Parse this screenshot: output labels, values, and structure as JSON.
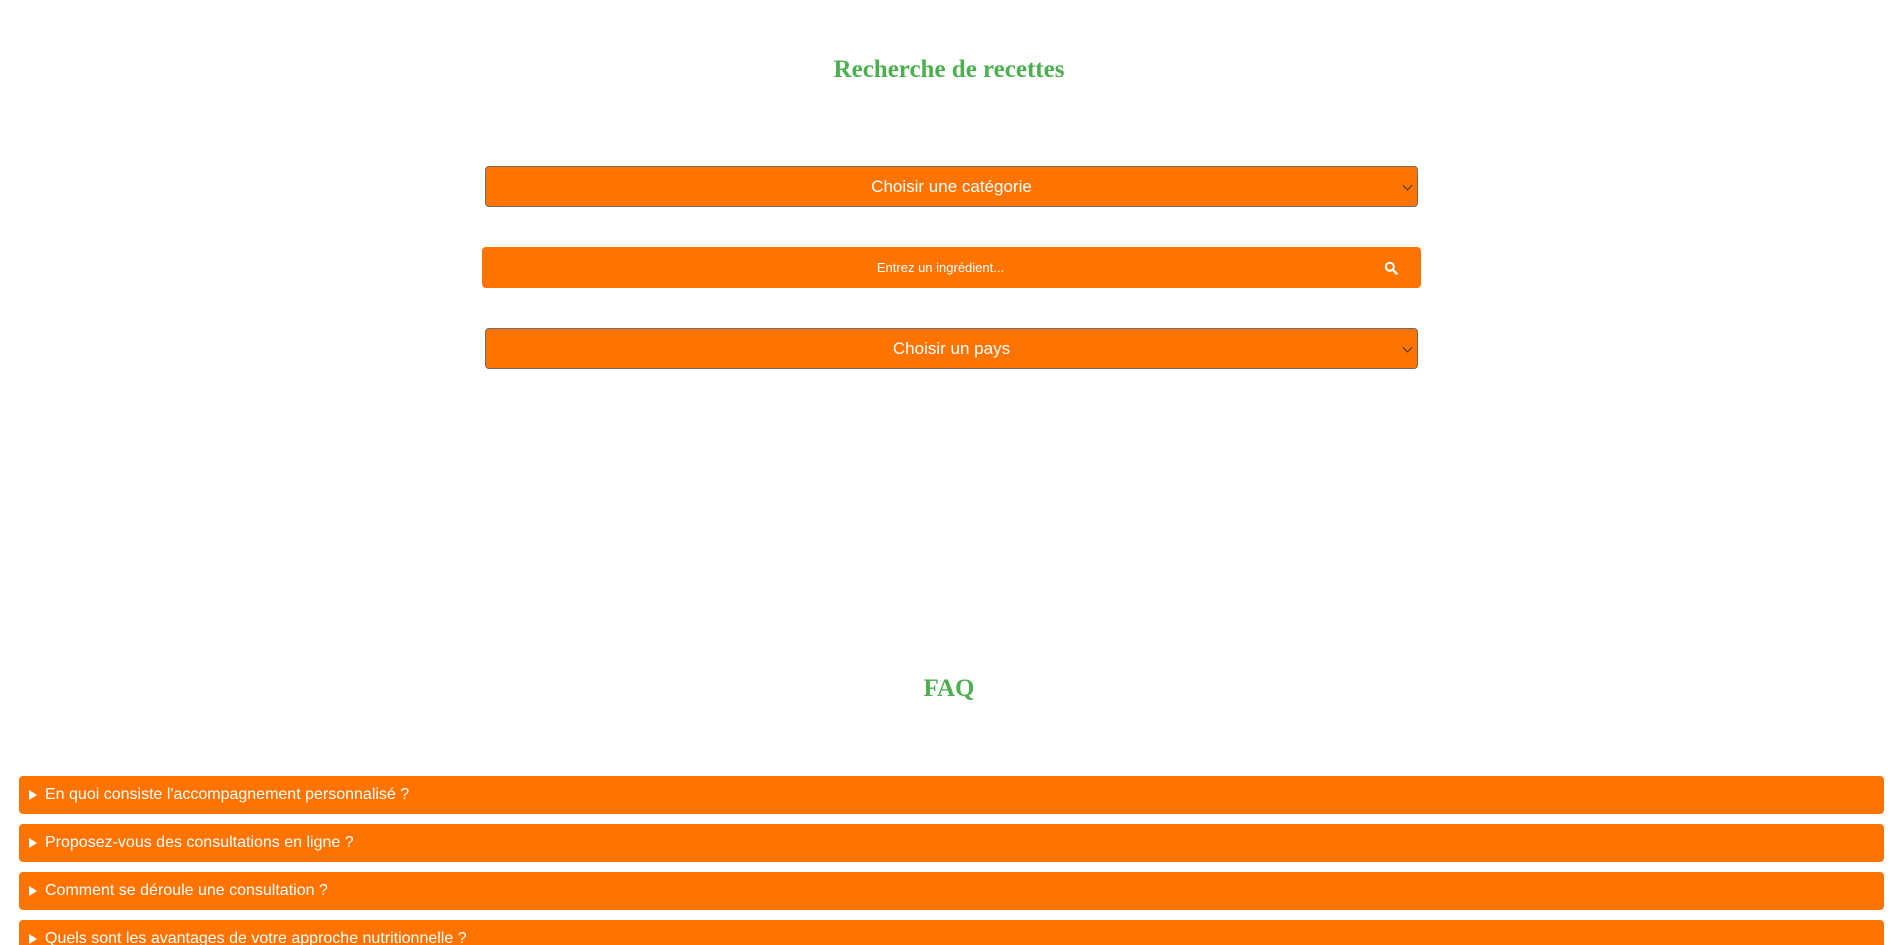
{
  "search_section": {
    "title": "Recherche de recettes",
    "category_select": {
      "selected": "Choisir une catégorie",
      "icon": "chevron-down-icon"
    },
    "ingredient_search": {
      "placeholder": "Entrez un ingrédient...",
      "icon": "search-icon"
    },
    "country_select": {
      "selected": "Choisir un pays",
      "icon": "chevron-down-icon"
    }
  },
  "faq_section": {
    "title": "FAQ",
    "items": [
      {
        "question": "En quoi consiste l'accompagnement personnalisé ?"
      },
      {
        "question": "Proposez-vous des consultations en ligne ?"
      },
      {
        "question": "Comment se déroule une consultation ?"
      },
      {
        "question": "Quels sont les avantages de votre approche nutritionnelle ?"
      }
    ]
  },
  "colors": {
    "accent": "#ff7300",
    "heading": "#4caf50",
    "text_on_accent": "#ffffff"
  }
}
